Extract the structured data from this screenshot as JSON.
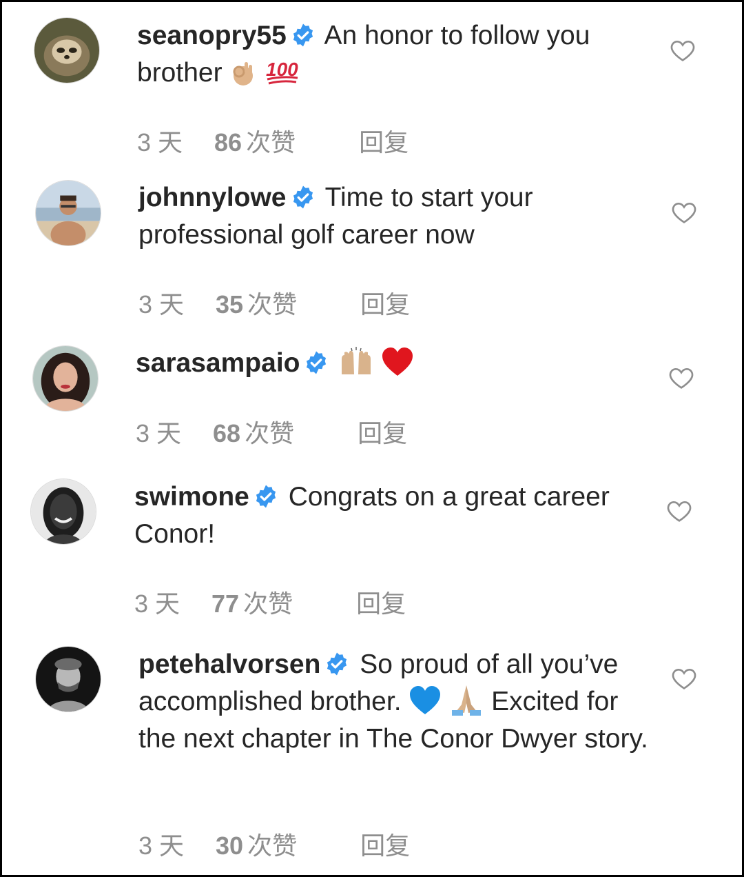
{
  "comments": [
    {
      "username": "seanopry55",
      "text_before": "An honor to follow you brother",
      "emojis": [
        "ok-hand",
        "hundred-points"
      ],
      "text_after": "",
      "time": "3 天",
      "likes": "86",
      "likes_unit": "次赞",
      "reply": "回复",
      "verified": true
    },
    {
      "username": "johnnylowe",
      "text_before": "Time to start your professional golf career now",
      "emojis": [],
      "text_after": "",
      "time": "3 天",
      "likes": "35",
      "likes_unit": "次赞",
      "reply": "回复",
      "verified": true
    },
    {
      "username": "sarasampaio",
      "text_before": "",
      "emojis": [
        "raising-hands",
        "red-heart"
      ],
      "text_after": "",
      "time": "3 天",
      "likes": "68",
      "likes_unit": "次赞",
      "reply": "回复",
      "verified": true
    },
    {
      "username": "swimone",
      "text_before": "Congrats on a great career Conor!",
      "emojis": [],
      "text_after": "",
      "time": "3 天",
      "likes": "77",
      "likes_unit": "次赞",
      "reply": "回复",
      "verified": true
    },
    {
      "username": "petehalvorsen",
      "text_before": "So proud of all you’ve accomplished brother.",
      "emojis": [
        "blue-heart",
        "folded-hands"
      ],
      "text_after": "Excited for the next chapter in The Conor Dwyer story.",
      "time": "3 天",
      "likes": "30",
      "likes_unit": "次赞",
      "reply": "回复",
      "verified": true
    }
  ],
  "colors": {
    "text": "#262626",
    "meta": "#8e8e8e",
    "verified_badge": "#3897f0",
    "heart_outline": "#8e8e8e"
  }
}
